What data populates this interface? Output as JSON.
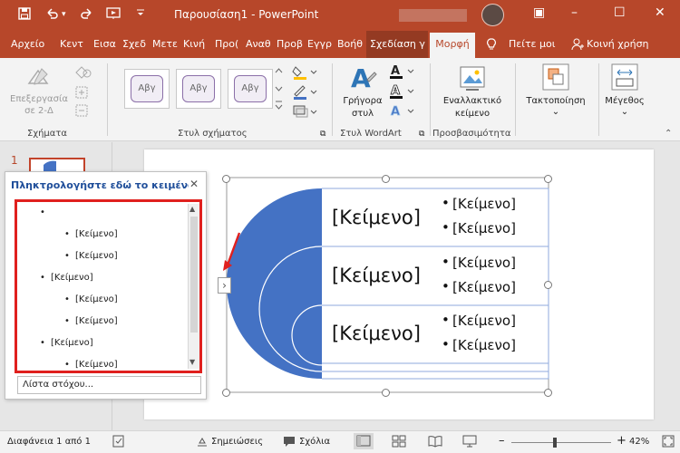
{
  "window": {
    "title": "Παρουσίαση1  -  PowerPoint",
    "controls": {
      "ribbon_display": "▣",
      "minimize": "–",
      "maximize": "☐",
      "close": "✕"
    }
  },
  "quick_access": {
    "save": "💾",
    "undo": "↶",
    "redo": "↷",
    "start": "▣",
    "more": "▾"
  },
  "tabs": {
    "items": [
      {
        "label": "Αρχείο"
      },
      {
        "label": "Κεντ"
      },
      {
        "label": "Εισα"
      },
      {
        "label": "Σχεδ"
      },
      {
        "label": "Μετε"
      },
      {
        "label": "Κινή"
      },
      {
        "label": "Προ("
      },
      {
        "label": "Αναθ"
      },
      {
        "label": "Προβ"
      },
      {
        "label": "Εγγρ"
      },
      {
        "label": "Βοήθ"
      }
    ],
    "context": "Σχεδίαση γ",
    "active": "Μορφή",
    "tell_me": "Πείτε μοι",
    "share": "Κοινή χρήση",
    "share_icon": "person-icon",
    "tell_me_icon": "lightbulb-icon"
  },
  "ribbon": {
    "shapes": {
      "edit2d_line1": "Επεξεργασία",
      "edit2d_line2": "σε 2-Δ",
      "label": "Σχήματα"
    },
    "shape_styles": {
      "sample": "Αβγ",
      "label": "Στυλ σχήματος"
    },
    "wordart": {
      "quick_styles_line1": "Γρήγορα",
      "quick_styles_line2": "στυλ",
      "label": "Στυλ WordArt",
      "letter": "A"
    },
    "accessibility": {
      "alt_text_line1": "Εναλλακτικό",
      "alt_text_line2": "κείμενο",
      "label": "Προσβασιμότητα"
    },
    "arrange": {
      "label": "Τακτοποίηση",
      "arrow": "⌄"
    },
    "size": {
      "label": "Μέγεθος",
      "arrow": "⌄"
    },
    "collapse": "⌃",
    "launcher": "⧉"
  },
  "thumbnails": {
    "slide_number": "1"
  },
  "text_pane": {
    "header": "Πληκτρολογήστε εδώ το κειμένο...",
    "close": "✕",
    "items": [
      {
        "level": 1,
        "text": ""
      },
      {
        "level": 2,
        "text": "[Κείμενο]"
      },
      {
        "level": 2,
        "text": "[Κείμενο]"
      },
      {
        "level": 1,
        "text": "[Κείμενο]"
      },
      {
        "level": 2,
        "text": "[Κείμενο]"
      },
      {
        "level": 2,
        "text": "[Κείμενο]"
      },
      {
        "level": 1,
        "text": "[Κείμενο]"
      },
      {
        "level": 2,
        "text": "[Κείμενο]"
      }
    ],
    "bullet": "•",
    "scroll_up": "▲",
    "scroll_down": "▼",
    "footer": "Λίστα στόχου..."
  },
  "smartart": {
    "expand": "›",
    "rows": [
      {
        "main": "[Κείμενο]",
        "bullets": [
          "[Κείμενο]",
          "[Κείμενο]"
        ]
      },
      {
        "main": "[Κείμενο]",
        "bullets": [
          "[Κείμενο]",
          "[Κείμενο]"
        ]
      },
      {
        "main": "[Κείμενο]",
        "bullets": [
          "[Κείμενο]",
          "[Κείμενο]"
        ]
      }
    ],
    "bullet": "•",
    "accent_color": "#4472c4"
  },
  "status": {
    "slide_info": "Διαφάνεια 1 από 1",
    "notes": "Σημειώσεις",
    "comments": "Σχόλια",
    "zoom_out": "–",
    "zoom_in": "+",
    "zoom": "42%",
    "zoom_fraction": 0.42
  },
  "colors": {
    "brand": "#b7472a",
    "ribbon_bg": "#f3f3f3",
    "highlight": "#e0201e"
  }
}
